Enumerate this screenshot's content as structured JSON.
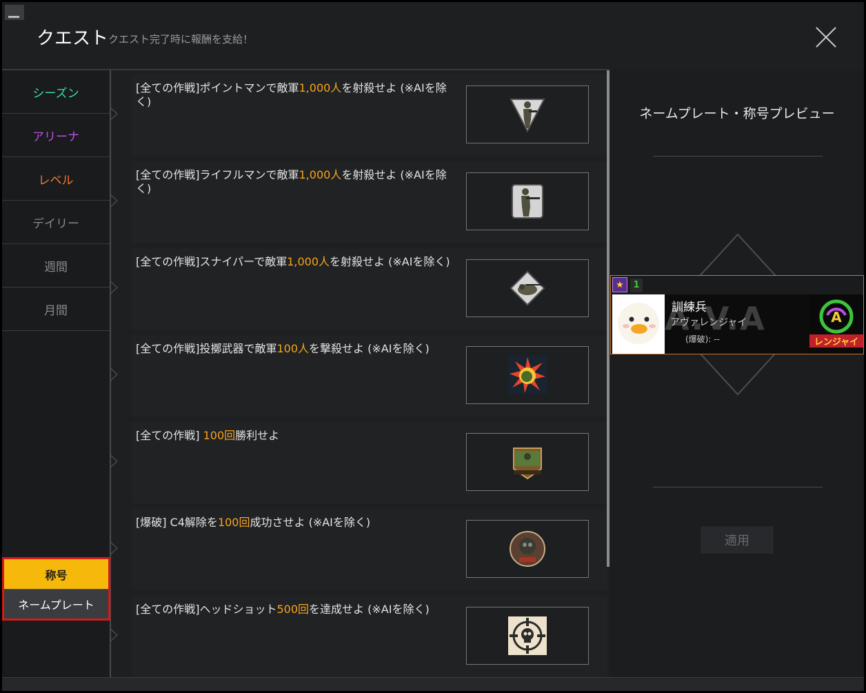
{
  "header": {
    "title": "クエスト",
    "subtitle": "クエスト完了時に報酬を支給！"
  },
  "sidebar": {
    "items": [
      {
        "label": "シーズン",
        "color": "#3ed9a8"
      },
      {
        "label": "アリーナ",
        "color": "#c04ee8"
      },
      {
        "label": "レベル",
        "color": "#f07a2e"
      },
      {
        "label": "デイリー",
        "color": "#8a8a8a"
      },
      {
        "label": "週間",
        "color": "#8a8a8a"
      },
      {
        "label": "月間",
        "color": "#8a8a8a"
      }
    ],
    "toggle": {
      "title_label": "称号",
      "nameplate_label": "ネームプレート"
    }
  },
  "quests": [
    {
      "pre": "[全ての作戦]ポイントマンで敵軍",
      "hl": "1,000人",
      "post": "を射殺せよ (※AIを除く)",
      "icon": "pointman-badge-icon"
    },
    {
      "pre": "[全ての作戦]ライフルマンで敵軍",
      "hl": "1,000人",
      "post": "を射殺せよ (※AIを除く)",
      "icon": "rifleman-badge-icon"
    },
    {
      "pre": "[全ての作戦]スナイパーで敵軍",
      "hl": "1,000人",
      "post": "を射殺せよ (※AIを除く)",
      "icon": "sniper-badge-icon"
    },
    {
      "pre": "[全ての作戦]投擲武器で敵軍",
      "hl": "100人",
      "post": "を撃殺せよ (※AIを除く)",
      "icon": "grenade-explosion-icon"
    },
    {
      "pre": "[全ての作戦] ",
      "hl": "100回",
      "post": "勝利せよ",
      "icon": "victory-badge-icon"
    },
    {
      "pre": "[爆破] C4解除を",
      "hl": "100回",
      "post": "成功させよ (※AIを除く)",
      "icon": "eod-badge-icon"
    },
    {
      "pre": "[全ての作戦]ヘッドショット",
      "hl": "500回",
      "post": "を達成せよ (※AIを除く)",
      "icon": "skull-crosshair-icon"
    }
  ],
  "preview": {
    "title": "ネームプレート・称号プレビュー",
    "apply_label": "適用",
    "nameplate": {
      "level": "1",
      "name": "訓練兵",
      "title": "アヴァレンジャイ",
      "record": "(爆破): --",
      "logo_text": "A.V.A",
      "emblem_text": "レンジャイ"
    }
  },
  "colors": {
    "highlight": "#f7a51c",
    "active_toggle": "#f7b80c",
    "toggle_border": "#d61a1a"
  }
}
